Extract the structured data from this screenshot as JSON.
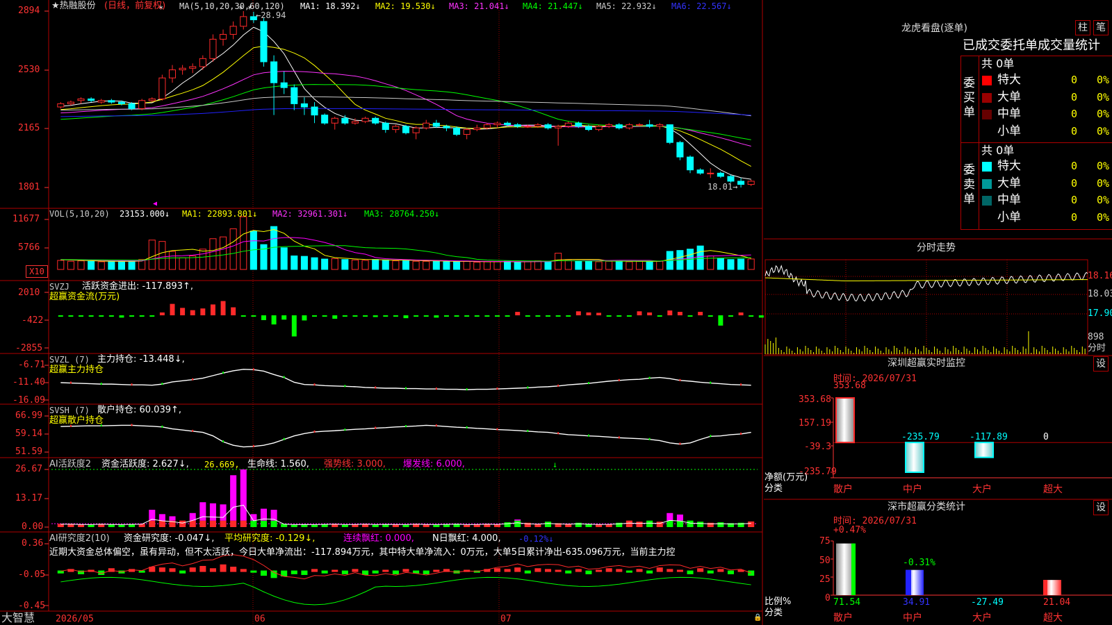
{
  "colors": {
    "up": "#ff2a2a",
    "down": "#00ffff",
    "ma1": "#ffffff",
    "ma2": "#ffff00",
    "ma3": "#ff33ff",
    "ma4": "#00ff00",
    "ma5": "#c8c8c8",
    "ma6": "#2222ff",
    "grid": "#b00000",
    "axis": "#ff3333",
    "yellow": "#ffff00",
    "green": "#00ff00",
    "cyan": "#00ffff",
    "white": "#ffffff",
    "magenta": "#ff00ff"
  },
  "main": {
    "title": "★热融股份",
    "period": "(日线，前复权)",
    "ma_params": "MA(5,10,20,30,60,120)",
    "ma": [
      {
        "label": "MA1: 18.392↓",
        "color": "#ffffff"
      },
      {
        "label": "MA2: 19.530↓",
        "color": "#ffff00"
      },
      {
        "label": "MA3: 21.041↓",
        "color": "#ff33ff"
      },
      {
        "label": "MA4: 21.447↓",
        "color": "#00ff00"
      },
      {
        "label": "MA5: 22.932↓",
        "color": "#c8c8c8"
      },
      {
        "label": "MA6: 22.567↓",
        "color": "#2222ff"
      }
    ],
    "high_label": "28.94",
    "low_label": "18.01",
    "yticks": [
      "2894",
      "2530",
      "2165",
      "1801"
    ]
  },
  "vol": {
    "title": "VOL(5,10,20)",
    "value": "23153.000↓",
    "ma1": "MA1: 22893.801↓",
    "ma2": "MA2: 32961.301↓",
    "ma3": "MA3: 28764.250↓",
    "yticks": [
      "11677",
      "5766"
    ],
    "unit": "X10"
  },
  "svzj": {
    "title": "SVZJ",
    "label": "活跃资金进出: -117.893↑,",
    "sub": "超赢资金流(万元)",
    "yticks": [
      "2010",
      "-422",
      "-2855"
    ]
  },
  "svzl": {
    "title": "SVZL (7)",
    "label": "主力持仓: -13.448↓,",
    "sub": "超赢主力持仓",
    "yticks": [
      "-6.71",
      "-11.40",
      "-16.09"
    ]
  },
  "svsh": {
    "title": "SVSH (7)",
    "label": "散户持仓: 60.039↑,",
    "sub": "超赢散户持仓",
    "yticks": [
      "66.99",
      "59.14",
      "51.59"
    ]
  },
  "ai1": {
    "title": "AI活跃度2",
    "l1": "资金活跃度: 2.627↓,",
    "l2": "26.669,",
    "l3": "生命线: 1.560,",
    "l4": "强势线: 3.000,",
    "l5": "爆发线: 6.000,",
    "yticks": [
      "26.67",
      "13.17",
      "0.00"
    ]
  },
  "ai2": {
    "title": "AI研究度2(10)",
    "l1": "资金研究度: -0.047↓,",
    "l2": "平均研究度: -0.129↓,",
    "l3": "连续飘红: 0.000,",
    "l4": "N日飘红: 4.000,",
    "l5": "-0.12%↓",
    "comment": "近期大资金总体偏空，虽有异动，但不太活跃，今日大单净流出：-117.894万元，其中特大单净流入：0万元，大单5日累计净出-635.096万元，当前主力控",
    "yticks": [
      "0.36",
      "-0.05",
      "-0.45"
    ]
  },
  "xaxis": {
    "brand": "大智慧",
    "labels": [
      "2026/05",
      "06",
      "07"
    ]
  },
  "lhb": {
    "title": "龙虎看盘(逐单)",
    "btn1": "柱",
    "btn2": "笔",
    "header": "已成交委托单成交量统计",
    "buy": {
      "total": "共 0单",
      "side": "委买单",
      "rows": [
        {
          "name": "特大",
          "n": "0",
          "p": "0%",
          "color": "#ff0000"
        },
        {
          "name": "大单",
          "n": "0",
          "p": "0%",
          "color": "#990000"
        },
        {
          "name": "中单",
          "n": "0",
          "p": "0%",
          "color": "#660000"
        },
        {
          "name": "小单",
          "n": "0",
          "p": "0%",
          "color": "#000000"
        }
      ]
    },
    "sell": {
      "total": "共 0单",
      "side": "委卖单",
      "rows": [
        {
          "name": "特大",
          "n": "0",
          "p": "0%",
          "color": "#00ffff"
        },
        {
          "name": "大单",
          "n": "0",
          "p": "0%",
          "color": "#009999"
        },
        {
          "name": "中单",
          "n": "0",
          "p": "0%",
          "color": "#006666"
        },
        {
          "name": "小单",
          "n": "0",
          "p": "0%",
          "color": "#000000"
        }
      ]
    }
  },
  "fenshi": {
    "title": "分时走势",
    "yticks": [
      "18.16",
      "18.03",
      "17.90"
    ],
    "vol_label": "898",
    "unit_label": "分时"
  },
  "sz": {
    "title": "深圳超赢实时监控",
    "btn": "设",
    "time": "时间: 2026/07/31",
    "yticks": [
      "353.68",
      "157.19",
      "-39.3",
      "-235.79"
    ],
    "ylabel": "净额(万元)",
    "xlabel": "分类",
    "cats": [
      "散户",
      "中户",
      "大户",
      "超大"
    ],
    "values": [
      "353.68",
      "-235.79",
      "-117.89",
      "0"
    ]
  },
  "ss": {
    "title": "深市超赢分类统计",
    "btn": "设",
    "time": "时间: 2026/07/31",
    "yticks": [
      "75",
      "50",
      "25",
      "0"
    ],
    "ylabel": "比例%",
    "xlabel": "分类",
    "cats": [
      "散户",
      "中户",
      "大户",
      "超大"
    ],
    "top": [
      "+0.47%",
      "-0.31%",
      "",
      ""
    ],
    "values": [
      "71.54",
      "34.91",
      "-27.49",
      "21.04"
    ]
  },
  "chart_data": [
    {
      "type": "candlestick",
      "title": "热融股份",
      "ylim": [
        18.01,
        28.94
      ],
      "note": "daily prices approx",
      "ohlc": [
        [
          23.0,
          23.3,
          22.9,
          23.2
        ],
        [
          23.2,
          23.4,
          23.1,
          23.3
        ],
        [
          23.4,
          23.6,
          23.2,
          23.5
        ],
        [
          23.5,
          23.6,
          23.3,
          23.4
        ],
        [
          23.3,
          23.5,
          23.2,
          23.4
        ],
        [
          23.4,
          23.5,
          23.2,
          23.3
        ],
        [
          23.3,
          23.4,
          23.1,
          23.2
        ],
        [
          23.2,
          23.3,
          22.8,
          22.9
        ],
        [
          22.9,
          23.5,
          22.8,
          23.4
        ],
        [
          23.4,
          23.6,
          23.3,
          23.5
        ],
        [
          23.5,
          25.0,
          23.4,
          24.8
        ],
        [
          24.8,
          25.6,
          24.5,
          25.3
        ],
        [
          25.3,
          25.6,
          25.0,
          25.4
        ],
        [
          25.4,
          25.7,
          25.1,
          25.5
        ],
        [
          25.5,
          26.2,
          25.3,
          26.0
        ],
        [
          26.0,
          27.5,
          25.8,
          27.2
        ],
        [
          27.2,
          27.8,
          26.8,
          27.5
        ],
        [
          27.5,
          28.3,
          27.2,
          28.0
        ],
        [
          28.0,
          28.94,
          27.8,
          28.6
        ],
        [
          28.6,
          28.9,
          28.2,
          28.4
        ],
        [
          28.3,
          28.5,
          25.5,
          25.8
        ],
        [
          25.8,
          26.2,
          22.5,
          24.5
        ],
        [
          24.5,
          25.2,
          23.8,
          24.2
        ],
        [
          24.2,
          24.4,
          22.8,
          23.2
        ],
        [
          23.2,
          23.6,
          22.5,
          23.0
        ],
        [
          23.0,
          23.3,
          22.0,
          22.5
        ],
        [
          22.5,
          22.6,
          21.9,
          22.0
        ],
        [
          22.0,
          22.4,
          21.6,
          22.3
        ],
        [
          22.3,
          22.5,
          21.9,
          22.0
        ],
        [
          22.0,
          22.3,
          21.9,
          22.1
        ],
        [
          22.1,
          22.4,
          22.0,
          22.3
        ],
        [
          22.3,
          22.4,
          21.9,
          22.0
        ],
        [
          22.0,
          22.1,
          21.4,
          21.6
        ],
        [
          21.6,
          21.9,
          21.4,
          21.8
        ],
        [
          21.8,
          21.9,
          21.3,
          21.4
        ],
        [
          21.4,
          21.8,
          21.0,
          21.7
        ],
        [
          21.7,
          22.2,
          21.6,
          22.0
        ],
        [
          22.0,
          22.2,
          21.7,
          21.8
        ],
        [
          21.8,
          21.9,
          21.5,
          21.7
        ],
        [
          21.7,
          21.8,
          21.2,
          21.3
        ],
        [
          21.3,
          21.7,
          21.0,
          21.6
        ],
        [
          21.6,
          21.9,
          21.5,
          21.7
        ],
        [
          21.7,
          22.0,
          21.6,
          21.9
        ],
        [
          21.9,
          22.1,
          21.7,
          22.0
        ],
        [
          22.0,
          22.1,
          21.8,
          21.9
        ],
        [
          21.9,
          22.0,
          21.7,
          21.8
        ],
        [
          21.8,
          21.9,
          21.7,
          21.8
        ],
        [
          21.8,
          22.0,
          21.7,
          21.9
        ],
        [
          21.9,
          22.0,
          21.6,
          21.7
        ],
        [
          21.7,
          21.9,
          20.6,
          21.8
        ],
        [
          21.8,
          22.1,
          21.7,
          22.0
        ],
        [
          22.0,
          22.1,
          21.7,
          21.8
        ],
        [
          21.8,
          21.9,
          21.5,
          21.6
        ],
        [
          21.6,
          21.9,
          21.5,
          21.8
        ],
        [
          21.8,
          22.0,
          21.7,
          21.9
        ],
        [
          21.9,
          22.0,
          21.6,
          21.7
        ],
        [
          21.7,
          22.0,
          21.6,
          21.9
        ],
        [
          21.9,
          22.0,
          21.8,
          21.9
        ],
        [
          21.9,
          22.2,
          21.7,
          21.8
        ],
        [
          21.8,
          22.0,
          21.6,
          21.9
        ],
        [
          21.9,
          21.9,
          20.7,
          20.8
        ],
        [
          20.8,
          20.9,
          19.7,
          19.9
        ],
        [
          19.9,
          20.0,
          18.9,
          19.1
        ],
        [
          19.1,
          19.2,
          18.8,
          18.9
        ],
        [
          18.9,
          19.2,
          18.6,
          18.9
        ],
        [
          18.9,
          19.0,
          18.6,
          18.7
        ],
        [
          18.7,
          18.8,
          18.3,
          18.4
        ],
        [
          18.4,
          18.6,
          18.01,
          18.2
        ],
        [
          18.2,
          18.5,
          18.1,
          18.4
        ]
      ]
    },
    {
      "type": "bar",
      "title": "VOL",
      "ylim": [
        0,
        11677
      ],
      "values": [
        2000,
        1800,
        1900,
        1800,
        1700,
        1800,
        1700,
        1900,
        2200,
        6500,
        6200,
        4000,
        2600,
        3000,
        4500,
        6800,
        7200,
        9000,
        11677,
        8500,
        5500,
        9500,
        4800,
        3000,
        2900,
        2600,
        2300,
        2400,
        2200,
        2100,
        2000,
        2200,
        2100,
        1900,
        2000,
        1800,
        1800,
        1900,
        1700,
        1700,
        1800,
        1600,
        1700,
        1700,
        1800,
        1600,
        1700,
        1900,
        1800,
        3600,
        2000,
        1800,
        1900,
        1700,
        1800,
        1900,
        1700,
        1800,
        1700,
        1800,
        4000,
        4200,
        4500,
        5200,
        3000,
        2500,
        2200,
        2300,
        2315
      ]
    },
    {
      "type": "bar",
      "title": "SVZJ",
      "ylim": [
        -2855,
        2010
      ],
      "values": [
        -30,
        -40,
        -50,
        -60,
        -40,
        -70,
        -200,
        -80,
        -50,
        -40,
        250,
        1000,
        650,
        450,
        600,
        950,
        1250,
        700,
        -60,
        -100,
        -420,
        -800,
        -380,
        -1850,
        -450,
        -120,
        -80,
        -300,
        -100,
        -60,
        -90,
        -150,
        -110,
        -60,
        -250,
        -80,
        -100,
        -200,
        -50,
        -100,
        -60,
        -40,
        -80,
        -50,
        -50,
        300,
        -80,
        -60,
        -100,
        -50,
        -50,
        350,
        250,
        220,
        -40,
        -50,
        -60,
        350,
        250,
        -70,
        420,
        300,
        -50,
        300,
        -120,
        -900,
        -60,
        250,
        -100,
        -200,
        -118
      ]
    },
    {
      "type": "line",
      "title": "SVZL",
      "ylim": [
        -16.09,
        -6.71
      ],
      "values": [
        -11.4,
        -11.5,
        -11.6,
        -11.7,
        -11.8,
        -11.8,
        -11.9,
        -12.0,
        -12.0,
        -12.1,
        -11.8,
        -11.2,
        -10.9,
        -10.6,
        -10.2,
        -9.5,
        -8.8,
        -8.2,
        -7.8,
        -7.9,
        -8.3,
        -9.2,
        -10.0,
        -11.3,
        -11.9,
        -12.0,
        -12.2,
        -12.3,
        -12.4,
        -12.5,
        -12.7,
        -12.8,
        -12.9,
        -12.9,
        -13.0,
        -13.0,
        -13.1,
        -13.1,
        -13.2,
        -13.2,
        -13.3,
        -13.2,
        -13.2,
        -13.1,
        -13.0,
        -12.9,
        -12.8,
        -12.6,
        -12.5,
        -12.3,
        -12.0,
        -11.8,
        -11.6,
        -11.3,
        -11.0,
        -10.8,
        -10.6,
        -10.5,
        -10.2,
        -10.0,
        -10.3,
        -10.8,
        -11.0,
        -11.3,
        -11.5,
        -11.7,
        -11.9,
        -12.0,
        -12.1
      ]
    },
    {
      "type": "line",
      "title": "SVSH",
      "ylim": [
        51.59,
        66.99
      ],
      "values": [
        62.5,
        62.6,
        62.7,
        62.8,
        62.8,
        62.9,
        63.0,
        63.0,
        62.8,
        62.6,
        62.3,
        61.5,
        61.0,
        60.5,
        60.0,
        58.5,
        56.0,
        54.5,
        53.8,
        54.0,
        54.5,
        55.5,
        57.0,
        58.5,
        59.5,
        60.2,
        60.5,
        60.7,
        61.0,
        61.3,
        61.5,
        61.8,
        62.0,
        62.3,
        62.5,
        62.7,
        63.0,
        62.8,
        62.5,
        62.2,
        62.0,
        61.7,
        61.5,
        61.2,
        61.0,
        60.8,
        60.5,
        60.2,
        60.0,
        59.5,
        59.0,
        58.8,
        58.5,
        58.3,
        58.0,
        57.7,
        57.5,
        57.3,
        57.0,
        56.5,
        55.5,
        55.0,
        55.5,
        57.0,
        58.3,
        58.5,
        59.0,
        59.3,
        60.0
      ]
    },
    {
      "type": "bar",
      "title": "AI活跃度2",
      "ylim": [
        0,
        26.67
      ],
      "values": [
        1.5,
        1.5,
        1.2,
        1.0,
        1.5,
        1.2,
        1.0,
        1.3,
        1.5,
        8.0,
        6.0,
        5.0,
        3.0,
        6.5,
        11.5,
        11.0,
        10.5,
        24.0,
        26.67,
        6.0,
        8.5,
        8.0,
        1.5,
        1.0,
        1.2,
        1.0,
        1.3,
        1.5,
        1.0,
        1.2,
        1.5,
        1.0,
        1.3,
        1.2,
        1.0,
        1.5,
        1.2,
        1.0,
        1.3,
        1.5,
        1.0,
        1.2,
        1.5,
        1.2,
        2.2,
        3.5,
        2.0,
        1.5,
        2.5,
        1.8,
        1.5,
        2.0,
        1.5,
        1.2,
        1.3,
        2.0,
        3.0,
        2.5,
        3.0,
        2.5,
        6.5,
        5.8,
        3.0,
        2.5,
        2.0,
        2.2,
        1.8,
        2.0,
        2.6
      ]
    },
    {
      "type": "bar",
      "title": "AI研究度2",
      "ylim": [
        -0.45,
        0.36
      ],
      "values": [
        -0.02,
        0.02,
        -0.03,
        0.01,
        -0.04,
        0.03,
        -0.02,
        0.02,
        -0.01,
        0.05,
        0.04,
        0.03,
        -0.02,
        0.04,
        0.06,
        0.03,
        0.08,
        0.05,
        0.02,
        -0.01,
        -0.05,
        -0.08,
        -0.06,
        -0.03,
        -0.04,
        0.02,
        -0.02,
        0.01,
        -0.03,
        0.02,
        -0.04,
        -0.02,
        0.01,
        -0.03,
        0.02,
        -0.02,
        -0.03,
        0.01,
        0.02,
        -0.02,
        0.01,
        -0.01,
        0.02,
        0.03,
        0.02,
        0.04,
        -0.02,
        0.03,
        0.02,
        0.01,
        -0.02,
        0.02,
        -0.03,
        0.01,
        0.03,
        0.02,
        -0.01,
        0.02,
        -0.02,
        0.04,
        0.02,
        0.01,
        -0.03,
        0.03,
        -0.02,
        0.02,
        -0.03,
        0.01,
        -0.05
      ]
    },
    {
      "type": "bar",
      "title": "深圳超赢实时监控",
      "categories": [
        "散户",
        "中户",
        "大户",
        "超大"
      ],
      "values": [
        353.68,
        -235.79,
        -117.89,
        0
      ],
      "ylabel": "净额(万元)",
      "xlabel": "分类"
    },
    {
      "type": "bar",
      "title": "深市超赢分类统计",
      "categories": [
        "散户",
        "中户",
        "大户",
        "超大"
      ],
      "values": [
        71.54,
        34.91,
        27.49,
        21.04
      ],
      "ylabel": "比例%",
      "xlabel": "分类",
      "ylim": [
        0,
        75
      ]
    }
  ]
}
